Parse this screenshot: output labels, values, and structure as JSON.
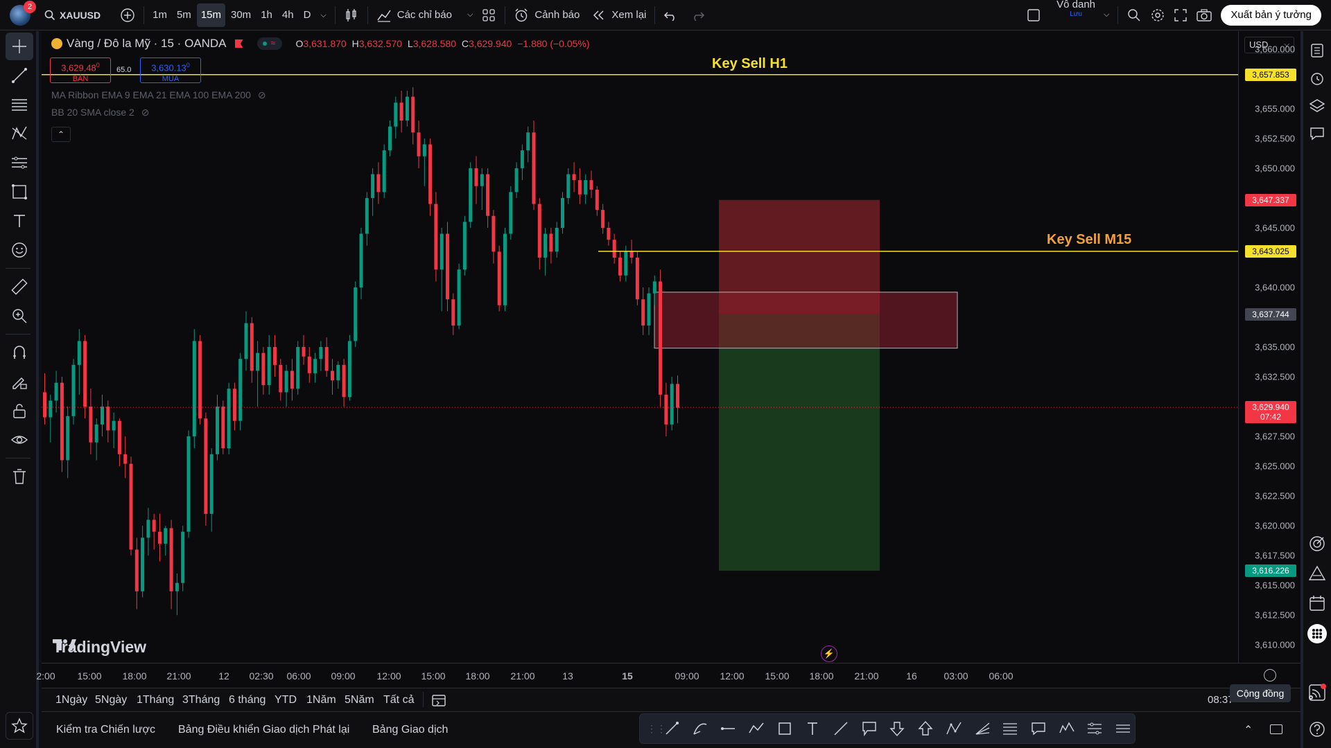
{
  "topbar": {
    "notification_count": "2",
    "symbol": "XAUUSD",
    "timeframes": [
      "1m",
      "5m",
      "15m",
      "30m",
      "1h",
      "4h",
      "D"
    ],
    "active_timeframe": "15m",
    "indicators_label": "Các chỉ báo",
    "alerts_label": "Cảnh báo",
    "replay_label": "Xem lại",
    "user_name": "Vô danh",
    "save_label": "Lưu",
    "publish_label": "Xuất bản ý tưởng"
  },
  "legend": {
    "title": "Vàng / Đô la Mỹ · 15 · OANDA",
    "open_key": "O",
    "open": "3,631.870",
    "high_key": "H",
    "high": "3,632.570",
    "low_key": "L",
    "low": "3,628.580",
    "close_key": "C",
    "close": "3,629.940",
    "change": "−1.880 (−0.05%)",
    "sell_price": "3,629.48",
    "sell_sup": "0",
    "sell_label": "BÁN",
    "spread": "65.0",
    "buy_price": "3,630.13",
    "buy_sup": "0",
    "buy_label": "MUA",
    "indicator_1": "MA Ribbon EMA 9 EMA 21 EMA 100 EMA 200",
    "indicator_2": "BB 20 SMA close 2"
  },
  "annotations": {
    "key_sell_h1": "Key Sell H1",
    "key_sell_m15": "Key Sell M15"
  },
  "brand": "TradingView",
  "price_axis": {
    "currency": "USD",
    "labels": [
      "3,660.000",
      "3,655.000",
      "3,652.500",
      "3,650.000",
      "3,645.000",
      "3,640.000",
      "3,635.000",
      "3,632.500",
      "3,627.500",
      "3,625.000",
      "3,622.500",
      "3,620.000",
      "3,617.500",
      "3,615.000",
      "3,612.500",
      "3,610.000"
    ],
    "tag_h1": "3,657.853",
    "tag_stop": "3,647.337",
    "tag_m15": "3,643.025",
    "tag_entry": "3,637.744",
    "tag_last": "3,629.940",
    "tag_countdown": "07:42",
    "tag_target": "3,616.226"
  },
  "time_axis": [
    "2:00",
    "15:00",
    "18:00",
    "21:00",
    "12",
    "02:30",
    "06:00",
    "09:00",
    "12:00",
    "15:00",
    "18:00",
    "21:00",
    "13",
    "15",
    "09:00",
    "12:00",
    "15:00",
    "18:00",
    "21:00",
    "16",
    "03:00",
    "06:00"
  ],
  "range_bar": {
    "ranges": [
      "1Ngày",
      "5Ngày",
      "1Tháng",
      "3Tháng",
      "6 tháng",
      "YTD",
      "1Năm",
      "5Năm",
      "Tất cả"
    ],
    "clock": "08:37"
  },
  "bottom_tabs": [
    "Kiểm tra Chiến lược",
    "Bảng Điều khiển Giao dịch Phát lại",
    "Bảng Giao dịch"
  ],
  "community_label": "Cộng đồng",
  "colors": {
    "up": "#089981",
    "down": "#f23645",
    "key_line": "#f5e12b",
    "stop_zone": "#6b1d24",
    "target_zone": "#1a3d1d"
  },
  "chart_data": {
    "type": "candlestick",
    "symbol": "XAUUSD",
    "interval": "15",
    "ylim": [
      3608.5,
      3661.5
    ],
    "key_levels": [
      {
        "name": "Key Sell H1",
        "price": 3657.853
      },
      {
        "name": "Key Sell M15",
        "price": 3643.025
      }
    ],
    "position": {
      "type": "short",
      "entry": 3637.744,
      "stop": 3647.337,
      "target": 3616.226
    },
    "last_price": 3629.94,
    "candles": [
      [
        3631.2,
        3632.8,
        3628.5,
        3629.1
      ],
      [
        3629.1,
        3631.0,
        3627.0,
        3630.5
      ],
      [
        3630.5,
        3633.0,
        3629.5,
        3632.0
      ],
      [
        3632.0,
        3632.5,
        3624.5,
        3625.5
      ],
      [
        3625.5,
        3630.0,
        3624.0,
        3629.2
      ],
      [
        3629.2,
        3634.0,
        3628.5,
        3633.5
      ],
      [
        3633.5,
        3636.5,
        3631.0,
        3635.5
      ],
      [
        3635.5,
        3636.0,
        3629.0,
        3630.0
      ],
      [
        3630.0,
        3631.5,
        3626.0,
        3627.0
      ],
      [
        3627.0,
        3629.0,
        3625.5,
        3628.5
      ],
      [
        3628.5,
        3631.0,
        3627.5,
        3630.0
      ],
      [
        3630.0,
        3630.5,
        3627.0,
        3628.0
      ],
      [
        3628.0,
        3629.5,
        3626.5,
        3628.8
      ],
      [
        3628.8,
        3629.0,
        3625.0,
        3626.0
      ],
      [
        3626.0,
        3627.5,
        3624.0,
        3625.2
      ],
      [
        3625.2,
        3625.8,
        3617.5,
        3618.0
      ],
      [
        3618.0,
        3619.0,
        3613.0,
        3614.5
      ],
      [
        3614.5,
        3620.0,
        3614.0,
        3619.0
      ],
      [
        3619.0,
        3621.5,
        3617.5,
        3620.5
      ],
      [
        3620.5,
        3621.0,
        3618.0,
        3619.5
      ],
      [
        3619.5,
        3621.0,
        3617.0,
        3618.5
      ],
      [
        3618.5,
        3620.0,
        3617.5,
        3619.8
      ],
      [
        3619.8,
        3620.5,
        3613.0,
        3614.5
      ],
      [
        3614.5,
        3616.0,
        3612.5,
        3615.2
      ],
      [
        3615.2,
        3620.0,
        3614.5,
        3619.5
      ],
      [
        3619.5,
        3628.0,
        3619.0,
        3627.5
      ],
      [
        3627.5,
        3636.5,
        3626.5,
        3635.5
      ],
      [
        3635.5,
        3636.0,
        3628.5,
        3629.0
      ],
      [
        3629.0,
        3629.5,
        3620.0,
        3621.0
      ],
      [
        3621.0,
        3626.5,
        3619.5,
        3626.0
      ],
      [
        3626.0,
        3631.0,
        3625.5,
        3630.0
      ],
      [
        3630.0,
        3630.5,
        3626.0,
        3626.5
      ],
      [
        3626.5,
        3632.0,
        3626.0,
        3631.5
      ],
      [
        3631.5,
        3632.0,
        3628.0,
        3628.8
      ],
      [
        3628.8,
        3634.5,
        3628.0,
        3634.0
      ],
      [
        3634.0,
        3638.0,
        3633.0,
        3637.0
      ],
      [
        3637.0,
        3637.5,
        3632.0,
        3633.0
      ],
      [
        3633.0,
        3635.5,
        3630.0,
        3634.5
      ],
      [
        3634.5,
        3635.0,
        3631.0,
        3631.8
      ],
      [
        3631.8,
        3636.0,
        3631.0,
        3635.0
      ],
      [
        3635.0,
        3636.0,
        3632.5,
        3633.5
      ],
      [
        3633.5,
        3634.0,
        3630.5,
        3631.2
      ],
      [
        3631.2,
        3633.5,
        3630.0,
        3633.0
      ],
      [
        3633.0,
        3634.0,
        3630.5,
        3631.5
      ],
      [
        3631.5,
        3635.5,
        3631.0,
        3635.0
      ],
      [
        3635.0,
        3636.0,
        3633.5,
        3634.2
      ],
      [
        3634.2,
        3635.0,
        3632.0,
        3632.8
      ],
      [
        3632.8,
        3634.5,
        3632.0,
        3634.0
      ],
      [
        3634.0,
        3635.5,
        3633.0,
        3635.0
      ],
      [
        3635.0,
        3635.8,
        3632.5,
        3633.0
      ],
      [
        3633.0,
        3634.0,
        3631.0,
        3632.2
      ],
      [
        3632.2,
        3633.8,
        3631.5,
        3633.5
      ],
      [
        3633.5,
        3634.0,
        3630.0,
        3630.8
      ],
      [
        3630.8,
        3636.0,
        3630.5,
        3635.5
      ],
      [
        3635.5,
        3640.5,
        3635.0,
        3640.0
      ],
      [
        3640.0,
        3645.0,
        3639.0,
        3644.5
      ],
      [
        3644.5,
        3648.0,
        3643.5,
        3647.5
      ],
      [
        3647.5,
        3650.0,
        3646.0,
        3649.5
      ],
      [
        3649.5,
        3650.5,
        3647.0,
        3648.0
      ],
      [
        3648.0,
        3652.0,
        3647.5,
        3651.5
      ],
      [
        3651.5,
        3654.0,
        3651.0,
        3653.5
      ],
      [
        3653.5,
        3656.0,
        3652.5,
        3655.5
      ],
      [
        3655.5,
        3656.5,
        3653.0,
        3654.0
      ],
      [
        3654.0,
        3656.5,
        3653.5,
        3656.0
      ],
      [
        3656.0,
        3656.8,
        3652.0,
        3653.0
      ],
      [
        3653.0,
        3654.0,
        3650.0,
        3651.0
      ],
      [
        3651.0,
        3652.5,
        3648.5,
        3652.0
      ],
      [
        3652.0,
        3652.5,
        3646.0,
        3647.0
      ],
      [
        3647.0,
        3648.0,
        3640.5,
        3641.5
      ],
      [
        3641.5,
        3645.0,
        3638.0,
        3644.5
      ],
      [
        3644.5,
        3645.5,
        3638.0,
        3639.0
      ],
      [
        3639.0,
        3639.5,
        3636.0,
        3636.8
      ],
      [
        3636.8,
        3642.0,
        3636.5,
        3641.5
      ],
      [
        3641.5,
        3646.0,
        3641.0,
        3645.5
      ],
      [
        3645.5,
        3650.5,
        3645.0,
        3650.0
      ],
      [
        3650.0,
        3651.0,
        3647.0,
        3648.5
      ],
      [
        3648.5,
        3650.0,
        3646.5,
        3649.5
      ],
      [
        3649.5,
        3650.0,
        3645.0,
        3646.0
      ],
      [
        3646.0,
        3646.5,
        3642.0,
        3643.0
      ],
      [
        3643.0,
        3643.5,
        3638.0,
        3638.5
      ],
      [
        3638.5,
        3645.0,
        3638.0,
        3644.5
      ],
      [
        3644.5,
        3648.5,
        3644.0,
        3648.0
      ],
      [
        3648.0,
        3650.5,
        3647.5,
        3650.0
      ],
      [
        3650.0,
        3652.0,
        3649.0,
        3651.5
      ],
      [
        3651.5,
        3653.5,
        3650.5,
        3653.0
      ],
      [
        3653.0,
        3654.0,
        3646.5,
        3647.0
      ],
      [
        3647.0,
        3647.5,
        3641.5,
        3642.5
      ],
      [
        3642.5,
        3645.0,
        3641.0,
        3644.5
      ],
      [
        3644.5,
        3645.0,
        3642.0,
        3643.0
      ],
      [
        3643.0,
        3645.5,
        3642.5,
        3645.0
      ],
      [
        3645.0,
        3648.0,
        3644.5,
        3647.5
      ],
      [
        3647.5,
        3650.0,
        3647.0,
        3649.5
      ],
      [
        3649.5,
        3650.5,
        3648.0,
        3649.0
      ],
      [
        3649.0,
        3650.0,
        3647.0,
        3647.8
      ],
      [
        3647.8,
        3649.5,
        3647.0,
        3649.0
      ],
      [
        3649.0,
        3649.8,
        3647.5,
        3648.2
      ],
      [
        3648.2,
        3648.5,
        3646.0,
        3646.5
      ],
      [
        3646.5,
        3647.0,
        3644.5,
        3645.0
      ],
      [
        3645.0,
        3645.5,
        3643.5,
        3644.0
      ],
      [
        3644.0,
        3644.5,
        3642.0,
        3642.5
      ],
      [
        3642.5,
        3643.0,
        3640.5,
        3641.0
      ],
      [
        3641.0,
        3643.5,
        3640.5,
        3643.0
      ],
      [
        3643.0,
        3644.0,
        3642.0,
        3642.5
      ],
      [
        3642.5,
        3643.0,
        3638.5,
        3639.0
      ],
      [
        3639.0,
        3640.0,
        3636.0,
        3636.8
      ],
      [
        3636.8,
        3640.0,
        3636.0,
        3639.5
      ],
      [
        3639.5,
        3641.0,
        3638.5,
        3640.5
      ],
      [
        3640.5,
        3641.5,
        3630.0,
        3631.0
      ],
      [
        3631.0,
        3632.0,
        3627.5,
        3628.5
      ],
      [
        3628.5,
        3632.5,
        3628.0,
        3631.9
      ],
      [
        3631.9,
        3632.6,
        3628.6,
        3629.9
      ]
    ]
  }
}
